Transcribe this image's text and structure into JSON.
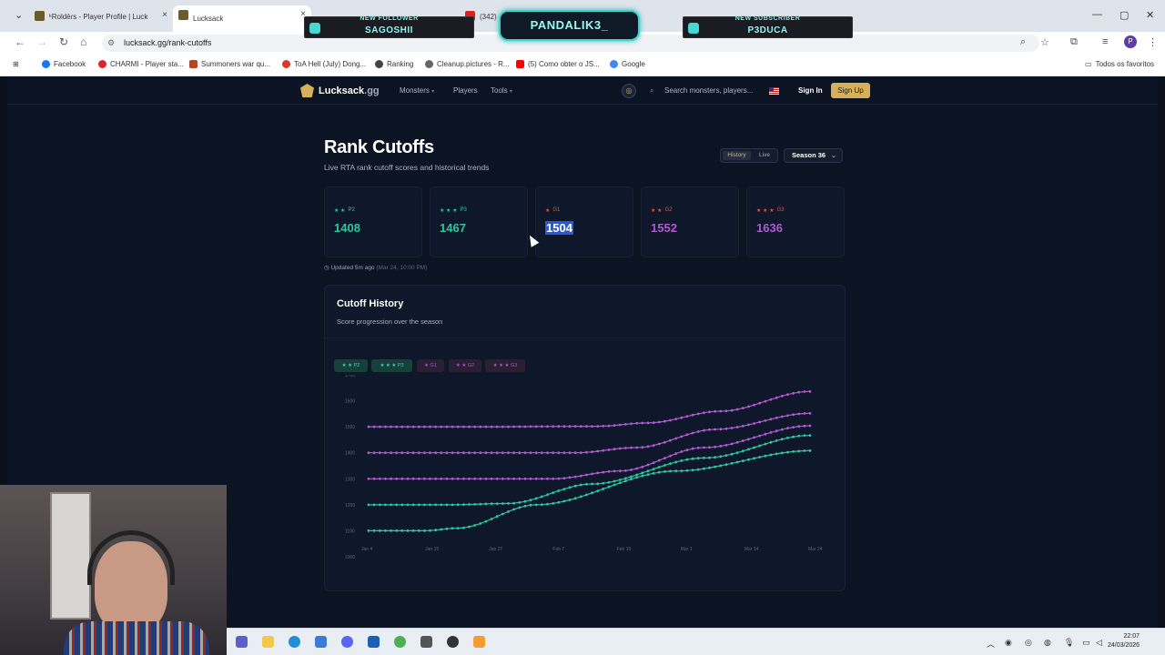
{
  "browser": {
    "tabs": [
      {
        "label": "ᵏRoldēɾs - Player Profile | Luck"
      },
      {
        "label": "Lucksack"
      },
      {
        "label": "(342)"
      }
    ],
    "url": "lucksack.gg/rank-cutoffs",
    "bookmarks": [
      {
        "label": "Facebook",
        "color": "#1877f2"
      },
      {
        "label": "CHARMI - Player sta...",
        "color": "#e0242c"
      },
      {
        "label": "Summoners war qu...",
        "color": "#b0462a"
      },
      {
        "label": "ToA Hell (July) Dong...",
        "color": "#d23b2b"
      },
      {
        "label": "Ranking",
        "color": "#444"
      },
      {
        "label": "Cleanup.pictures - R...",
        "color": "#666"
      },
      {
        "label": "(5) Como obter o JS...",
        "color": "#ff0000"
      },
      {
        "label": "Google",
        "color": "#4285f4"
      }
    ],
    "all_bookmarks": "Todos os favoritos",
    "profile_initial": "P"
  },
  "site": {
    "brand": "Lucksack",
    "brand_tld": ".gg",
    "nav": {
      "monsters": "Monsters",
      "players": "Players",
      "tools": "Tools"
    },
    "search_placeholder": "Search monsters, players...",
    "sign_in": "Sign In",
    "sign_up": "Sign Up"
  },
  "page": {
    "title": "Rank Cutoffs",
    "subtitle": "Live RTA rank cutoff scores and historical trends",
    "toggle": {
      "history": "History",
      "live": "Live"
    },
    "season": "Season 36",
    "updated": "Updated 5m ago",
    "updated_time": "(Mar 24, 10:00 PM)"
  },
  "cutoffs": [
    {
      "tier": "P2",
      "stars": "★ ★",
      "value": "1408",
      "color": "#2fc6a2",
      "star_color": "#2fc6a2"
    },
    {
      "tier": "P3",
      "stars": "★ ★ ★",
      "value": "1467",
      "color": "#2fc6a2",
      "star_color": "#2fc6a2"
    },
    {
      "tier": "G1",
      "stars": "★",
      "value": "1504",
      "color": "#ffffff",
      "star_color": "#e0533f"
    },
    {
      "tier": "G2",
      "stars": "★ ★",
      "value": "1552",
      "color": "#b05ad0",
      "star_color": "#e0533f"
    },
    {
      "tier": "G3",
      "stars": "★ ★ ★",
      "value": "1636",
      "color": "#b05ad0",
      "star_color": "#e0533f"
    }
  ],
  "history": {
    "title": "Cutoff History",
    "subtitle": "Score progression over the season",
    "chips": [
      {
        "label": "★ ★  P2",
        "bg": "#17403a",
        "fg": "#39d3b0"
      },
      {
        "label": "★ ★ ★  P3",
        "bg": "#17403a",
        "fg": "#39d3b0"
      },
      {
        "label": "★  G1",
        "bg": "#2a1f33",
        "fg": "#a15bb8"
      },
      {
        "label": "★ ★  G2",
        "bg": "#2a1f33",
        "fg": "#a15bb8"
      },
      {
        "label": "★ ★ ★  G3",
        "bg": "#2a1f33",
        "fg": "#a15bb8"
      }
    ]
  },
  "chart_data": {
    "type": "line",
    "title": "Cutoff History",
    "categories": [
      "Jan 4",
      "Jan 15",
      "Jan 27",
      "Feb 7",
      "Feb 18",
      "Mar 1",
      "Mar 14",
      "Mar 24"
    ],
    "ylim": [
      1000,
      1700
    ],
    "yticks": [
      1700,
      1600,
      1500,
      1400,
      1300,
      1200,
      1100,
      1000
    ],
    "ytick_labels": [
      "1700",
      "1600",
      "1500",
      "1400",
      "1300",
      "1200",
      "1100",
      "1000"
    ],
    "grid": false,
    "legend": "top-left",
    "series": [
      {
        "name": "G3",
        "color": "#b05ad0",
        "points": [
          [
            0,
            1500
          ],
          [
            20,
            1500
          ],
          [
            41,
            1502
          ],
          [
            50,
            1515
          ],
          [
            63,
            1560
          ],
          [
            79,
            1636
          ]
        ]
      },
      {
        "name": "G2",
        "color": "#b05ad0",
        "points": [
          [
            0,
            1400
          ],
          [
            20,
            1400
          ],
          [
            37,
            1400
          ],
          [
            48,
            1420
          ],
          [
            62,
            1490
          ],
          [
            79,
            1552
          ]
        ]
      },
      {
        "name": "G1",
        "color": "#b05ad0",
        "points": [
          [
            0,
            1300
          ],
          [
            20,
            1300
          ],
          [
            33,
            1300
          ],
          [
            45,
            1330
          ],
          [
            60,
            1420
          ],
          [
            79,
            1504
          ]
        ]
      },
      {
        "name": "P3",
        "color": "#2fc6a2",
        "points": [
          [
            0,
            1200
          ],
          [
            15,
            1200
          ],
          [
            25,
            1205
          ],
          [
            40,
            1280
          ],
          [
            60,
            1380
          ],
          [
            79,
            1467
          ]
        ]
      },
      {
        "name": "P2",
        "color": "#2fc6a2",
        "points": [
          [
            0,
            1100
          ],
          [
            10,
            1100
          ],
          [
            16,
            1110
          ],
          [
            30,
            1200
          ],
          [
            55,
            1330
          ],
          [
            79,
            1408
          ]
        ]
      }
    ]
  },
  "overlay": {
    "follower_label": "NEW FOLLOWER",
    "follower_name": "SAGOSHII",
    "channel": "PANDALIK3_",
    "subscriber_label": "NEW SUBSCRIBER",
    "subscriber_name": "P3DUCA"
  },
  "taskbar": {
    "time": "22:07",
    "date": "24/03/2026"
  }
}
